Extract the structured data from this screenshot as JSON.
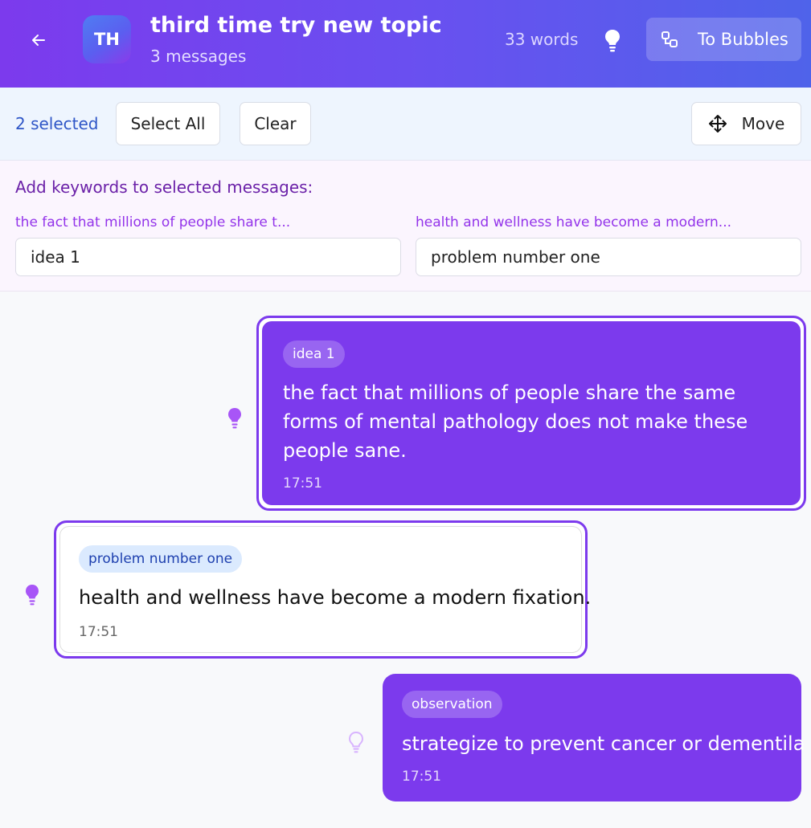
{
  "header": {
    "avatar_initials": "TH",
    "title": "third time try new topic",
    "subtitle": "3 messages",
    "word_count": "33 words",
    "to_bubbles_label": "To Bubbles"
  },
  "selection": {
    "count_label": "2 selected",
    "select_all_label": "Select All",
    "clear_label": "Clear",
    "move_label": "Move"
  },
  "keywords": {
    "heading": "Add keywords to selected messages:",
    "fields": [
      {
        "label": "the fact that millions of people share t...",
        "value": "idea 1"
      },
      {
        "label": "health and wellness have become a modern...",
        "value": "problem number one"
      }
    ]
  },
  "messages": [
    {
      "tag": "idea 1",
      "text": "the fact that millions of people share the same forms of mental pathology does not make these people sane.",
      "time": "17:51",
      "selected": true,
      "style": "purple"
    },
    {
      "tag": "problem number one",
      "text": "health and wellness have become a modern fixation.",
      "time": "17:51",
      "selected": true,
      "style": "white"
    },
    {
      "tag": "observation",
      "text": "strategize to prevent cancer or dementila",
      "time": "17:51",
      "selected": false,
      "style": "purple"
    }
  ],
  "colors": {
    "accent": "#7c3aed",
    "header_gradient_start": "#7c3aed",
    "header_gradient_end": "#4f63ea",
    "tag_blue_bg": "#dbeafe",
    "selection_text": "#2f56c7"
  },
  "icons": {
    "back": "arrow-left-icon",
    "header_bulb": "lightbulb-icon",
    "to_bubbles": "bubbles-icon",
    "move": "move-arrows-icon",
    "message_bulb": "lightbulb-icon"
  }
}
